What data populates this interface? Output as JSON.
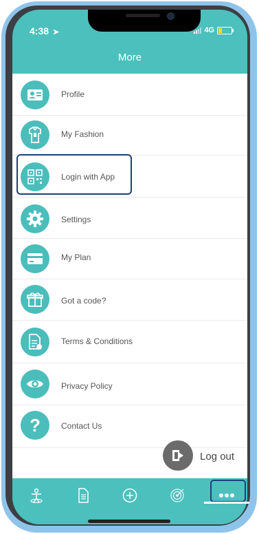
{
  "status_bar": {
    "time": "4:38",
    "network": "4G"
  },
  "header": {
    "title": "More"
  },
  "menu": {
    "items": [
      {
        "label": "Profile",
        "icon": "id-card-icon"
      },
      {
        "label": "My Fashion",
        "icon": "wardrobe-icon"
      },
      {
        "label": "Login with App",
        "icon": "qr-code-icon"
      },
      {
        "label": "Settings",
        "icon": "gear-icon"
      },
      {
        "label": "My Plan",
        "icon": "credit-card-icon"
      },
      {
        "label": "Got a code?",
        "icon": "gift-icon"
      },
      {
        "label": "Terms & Conditions",
        "icon": "document-icon"
      },
      {
        "label": "Privacy Policy",
        "icon": "eye-icon"
      },
      {
        "label": "Contact Us",
        "icon": "question-icon"
      }
    ]
  },
  "logout": {
    "label": "Log out"
  },
  "tabbar": {
    "tabs": [
      {
        "icon": "person-scan-icon"
      },
      {
        "icon": "document-icon"
      },
      {
        "icon": "plus-circle-icon"
      },
      {
        "icon": "target-icon"
      },
      {
        "icon": "more-dots-icon",
        "active": true
      }
    ]
  },
  "colors": {
    "accent": "#4cc0bd",
    "highlight_border": "#1e3f7d"
  }
}
